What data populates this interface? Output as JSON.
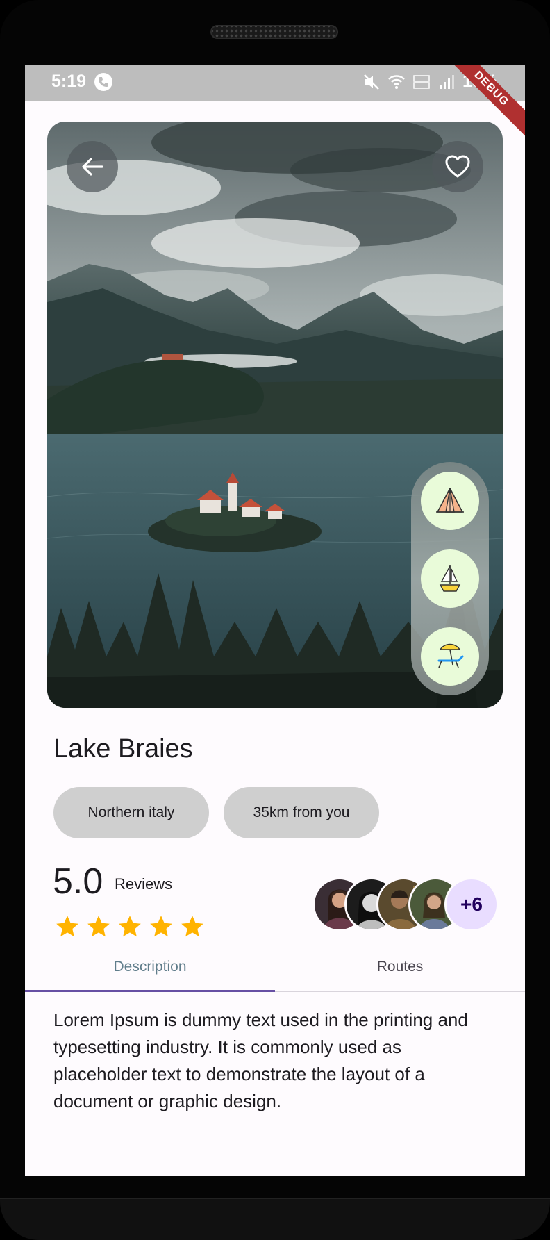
{
  "status_bar": {
    "time": "5:19",
    "battery": "19%",
    "debug_label": "DEBUG"
  },
  "hero": {
    "image_description_icon": "lake-landscape-image",
    "back_icon": "arrow-left-icon",
    "favorite_icon": "heart-outline-icon",
    "activities": [
      {
        "icon": "tent-icon"
      },
      {
        "icon": "sailboat-icon"
      },
      {
        "icon": "beach-chair-icon"
      }
    ]
  },
  "place": {
    "title": "Lake Braies",
    "tags": [
      "Northern italy",
      "35km from you"
    ]
  },
  "rating": {
    "value": "5.0",
    "label": "Reviews",
    "stars": 5,
    "star_color": "#ffb300",
    "more_reviewers": "+6"
  },
  "tabs": {
    "items": [
      "Description",
      "Routes"
    ],
    "active": "Description",
    "indicator_color": "#6750a4"
  },
  "description": {
    "text": "Lorem Ipsum is dummy text used in the printing and typesetting industry. It is commonly used as placeholder text to demonstrate the layout of a document or graphic design."
  }
}
